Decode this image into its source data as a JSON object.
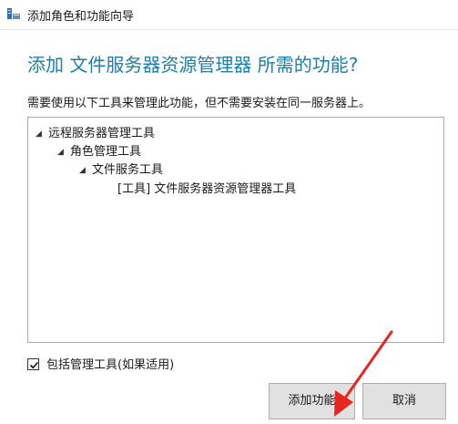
{
  "window": {
    "title": "添加角色和功能向导",
    "icon": "server-manager-icon"
  },
  "main": {
    "heading": "添加 文件服务器资源管理器 所需的功能?",
    "description": "需要使用以下工具来管理此功能，但不需要安装在同一服务器上。"
  },
  "tree": {
    "nodes": [
      {
        "label": "远程服务器管理工具",
        "expanded": true
      },
      {
        "label": "角色管理工具",
        "expanded": true
      },
      {
        "label": "文件服务工具",
        "expanded": true
      },
      {
        "label": "[工具] 文件服务器资源管理器工具"
      }
    ]
  },
  "options": {
    "include_tools_label": "包括管理工具(如果适用)",
    "include_tools_checked": true
  },
  "buttons": {
    "add_label": "添加功能",
    "cancel_label": "取消"
  },
  "colors": {
    "heading": "#1c7fa8",
    "annotation_arrow": "#e8261f"
  }
}
